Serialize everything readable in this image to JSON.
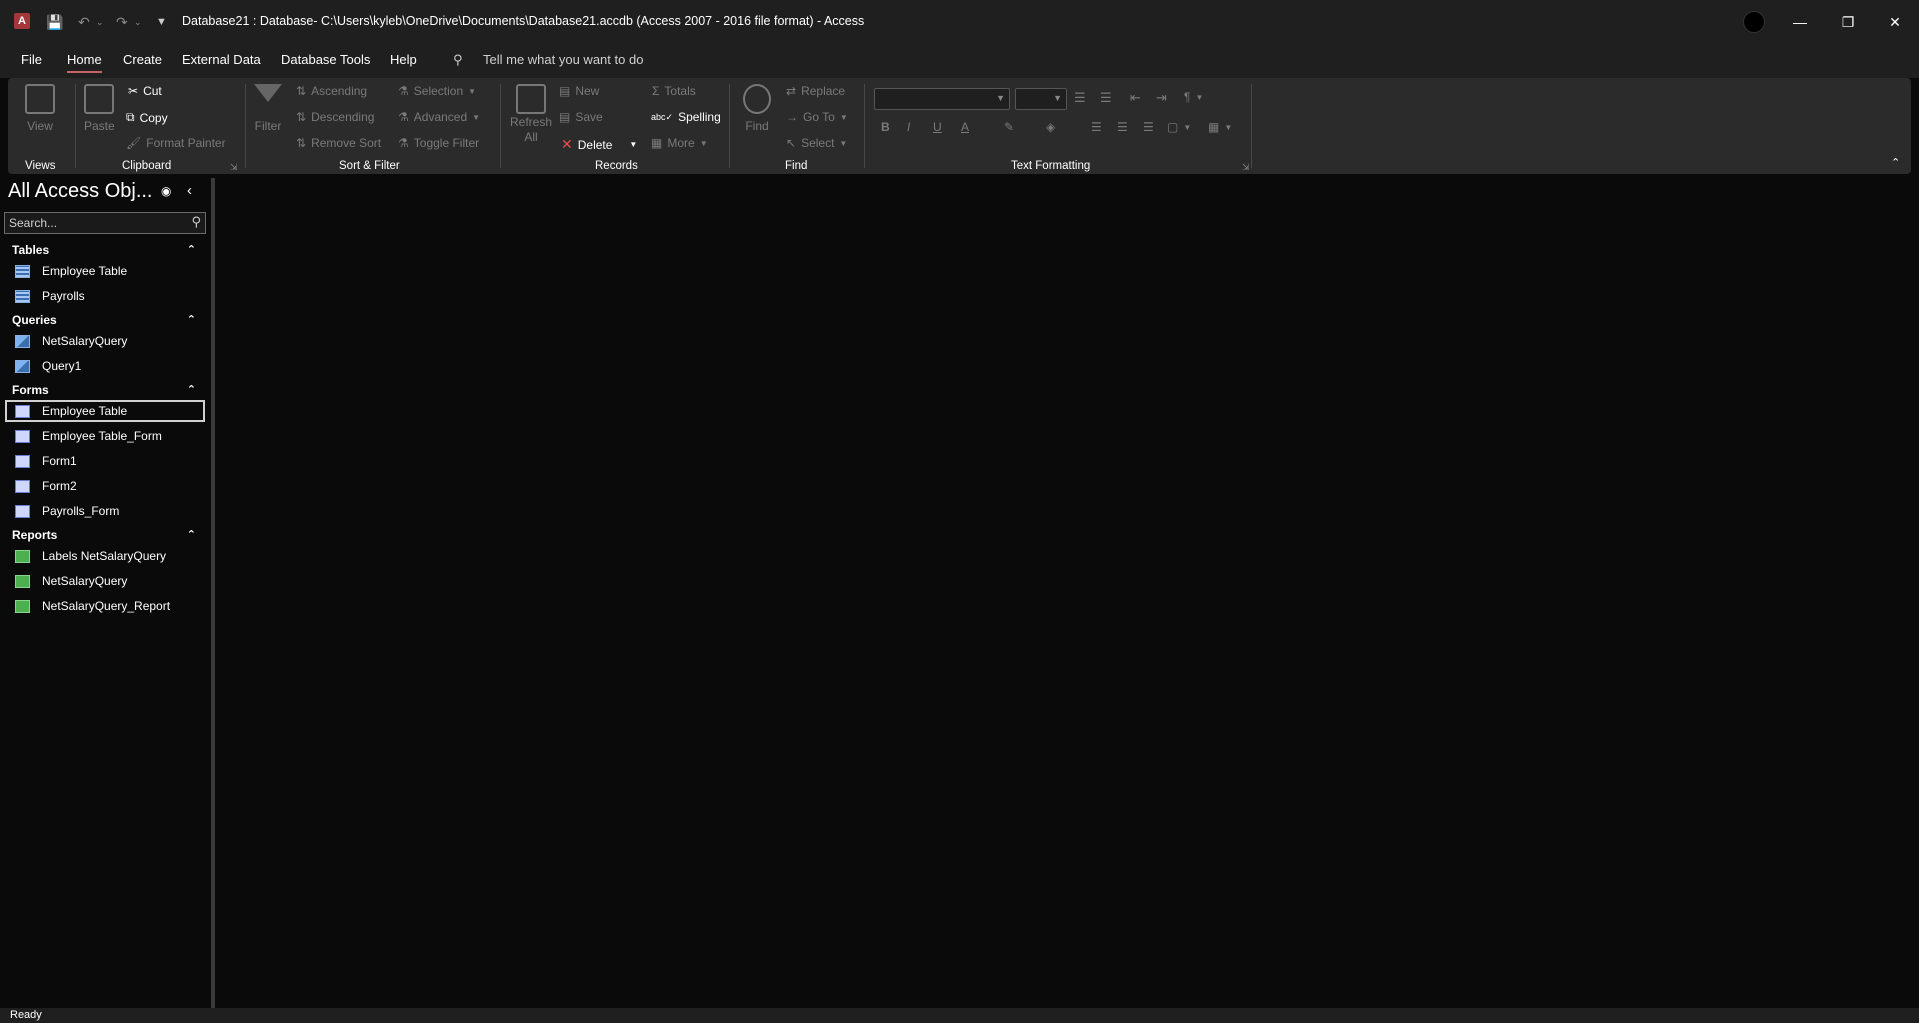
{
  "title_bar": {
    "title": "Database21 : Database- C:\\Users\\kyleb\\OneDrive\\Documents\\Database21.accdb (Access 2007 - 2016 file format)  -  Access",
    "app_icon": "access-logo-icon"
  },
  "tabs": [
    "File",
    "Home",
    "Create",
    "External Data",
    "Database Tools",
    "Help"
  ],
  "active_tab": "Home",
  "tell_me": "Tell me what you want to do",
  "ribbon": {
    "views": {
      "view": "View",
      "group": "Views"
    },
    "clipboard": {
      "paste": "Paste",
      "cut": "Cut",
      "copy": "Copy",
      "format_painter": "Format Painter",
      "group": "Clipboard"
    },
    "sort_filter": {
      "filter": "Filter",
      "ascending": "Ascending",
      "descending": "Descending",
      "remove_sort": "Remove Sort",
      "selection": "Selection",
      "advanced": "Advanced",
      "toggle_filter": "Toggle Filter",
      "group": "Sort & Filter"
    },
    "records": {
      "refresh": "Refresh",
      "refresh_all": "All",
      "new": "New",
      "save": "Save",
      "delete": "Delete",
      "totals": "Totals",
      "spelling": "Spelling",
      "more": "More",
      "group": "Records"
    },
    "find": {
      "find": "Find",
      "replace": "Replace",
      "goto": "Go To",
      "select": "Select",
      "group": "Find"
    },
    "text_formatting": {
      "group": "Text Formatting",
      "bold": "B",
      "italic": "I",
      "underline": "U",
      "font_color": "A"
    }
  },
  "nav": {
    "title": "All Access Obj...",
    "search_placeholder": "Search...",
    "sections": [
      {
        "name": "Tables",
        "items": [
          {
            "label": "Employee Table",
            "type": "table"
          },
          {
            "label": "Payrolls",
            "type": "table"
          }
        ]
      },
      {
        "name": "Queries",
        "items": [
          {
            "label": "NetSalaryQuery",
            "type": "query"
          },
          {
            "label": "Query1",
            "type": "query"
          }
        ]
      },
      {
        "name": "Forms",
        "items": [
          {
            "label": "Employee Table",
            "type": "form",
            "selected": true
          },
          {
            "label": "Employee Table_Form",
            "type": "form"
          },
          {
            "label": "Form1",
            "type": "form"
          },
          {
            "label": "Form2",
            "type": "form"
          },
          {
            "label": "Payrolls_Form",
            "type": "form"
          }
        ]
      },
      {
        "name": "Reports",
        "items": [
          {
            "label": "Labels NetSalaryQuery",
            "type": "report"
          },
          {
            "label": "NetSalaryQuery",
            "type": "report"
          },
          {
            "label": "NetSalaryQuery_Report",
            "type": "report"
          }
        ]
      }
    ]
  },
  "status": "Ready",
  "colors": {
    "accent": "#c86366",
    "background": "#0a0a0a",
    "ribbon": "#2b2b2b"
  }
}
